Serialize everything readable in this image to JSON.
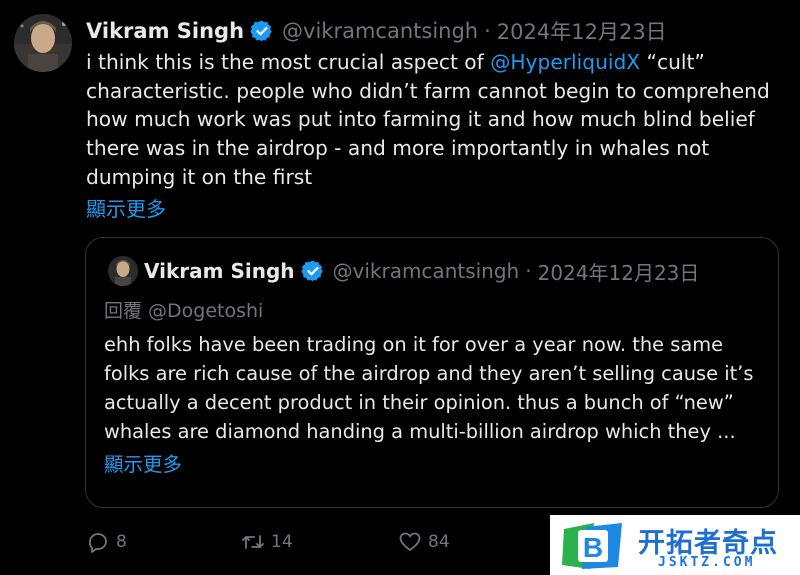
{
  "post": {
    "author_name": "Vikram Singh",
    "handle": "@vikramcantsingh",
    "separator": "·",
    "date": "2024年12月23日",
    "text_before_mention": "i think this is the most crucial aspect of ",
    "mention": "@HyperliquidX",
    "text_after_mention": " “cult” characteristic. people who didn’t farm cannot begin to comprehend how much work was put into farming it and how much blind belief there was in the airdrop - and more importantly in whales not dumping it on the first",
    "show_more": "顯示更多"
  },
  "quote": {
    "author_name": "Vikram Singh",
    "handle": "@vikramcantsingh",
    "separator": "·",
    "date": "2024年12月23日",
    "reply_to": "回覆 @Dogetoshi",
    "text": "ehh folks have been trading on it for over a year now. the same folks are rich cause of the airdrop and they aren’t selling cause it’s actually a decent product in their opinion. thus a bunch of “new” whales are diamond handing a multi-billion airdrop which they ...",
    "show_more": "顯示更多"
  },
  "actions": {
    "reply_count": "8",
    "retweet_count": "14",
    "like_count": "84"
  },
  "watermark": {
    "title": "开拓者奇点",
    "subtitle": "JSKTZ.COM",
    "logo_letter": "B"
  },
  "colors": {
    "background": "#000000",
    "text": "#e7e9ea",
    "muted": "#71767b",
    "link": "#1d9bf0",
    "border": "#2f3336"
  }
}
